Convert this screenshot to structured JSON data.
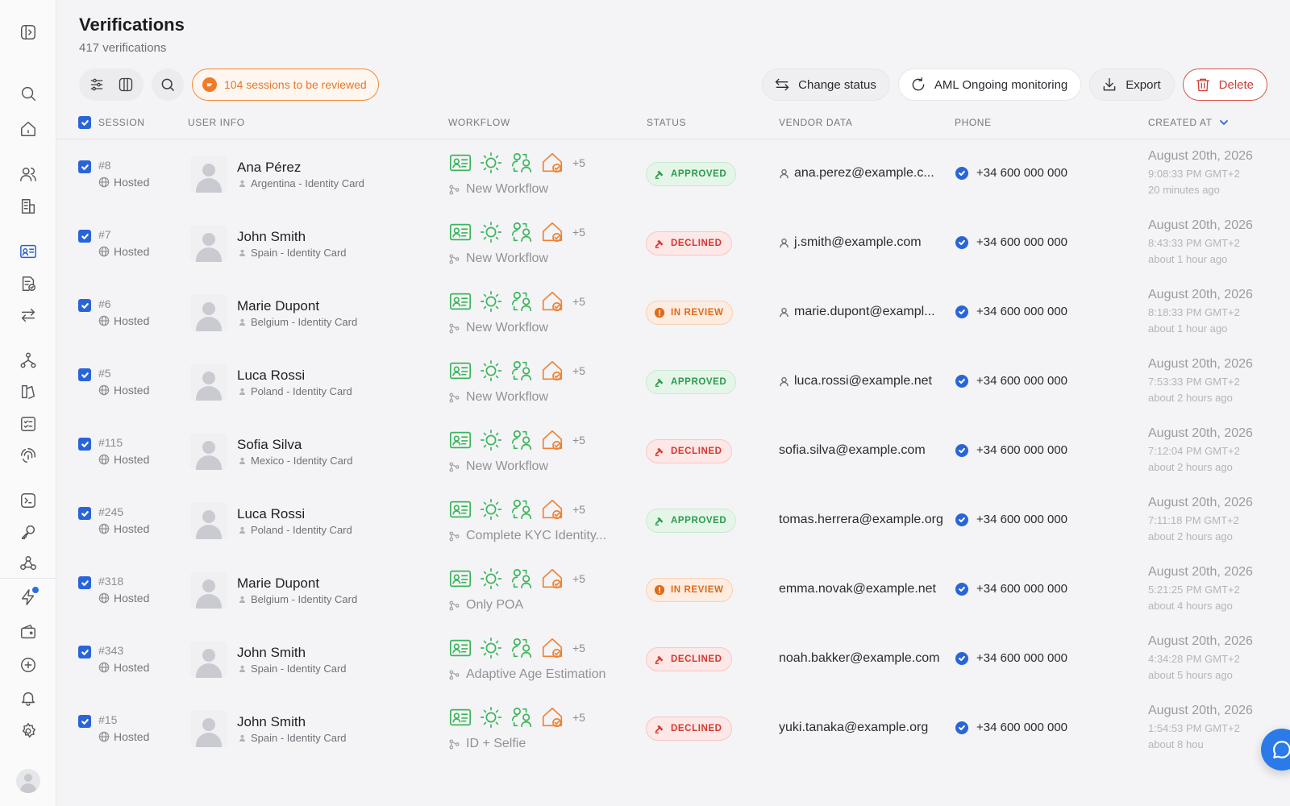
{
  "page": {
    "title": "Verifications",
    "subtitle": "417 verifications"
  },
  "toolbar": {
    "review_pill": "104 sessions to be reviewed",
    "change_status": "Change status",
    "aml": "AML Ongoing monitoring",
    "export": "Export",
    "delete": "Delete"
  },
  "columns": {
    "session": "SESSION",
    "user_info": "USER INFO",
    "workflow": "WORKFLOW",
    "status": "STATUS",
    "vendor_data": "VENDOR DATA",
    "phone": "PHONE",
    "created_at": "CREATED AT"
  },
  "status_labels": {
    "approved": "APPROVED",
    "declined": "DECLINED",
    "review": "IN REVIEW"
  },
  "colors": {
    "accent": "#2a65d8",
    "approved": "#2c9a4d",
    "declined": "#d5372e",
    "in_review": "#de6b1c",
    "workflow_green": "#3bb55b",
    "workflow_orange": "#ef8235"
  },
  "rows": [
    {
      "id": "#8",
      "type": "Hosted",
      "name": "Ana Pérez",
      "meta": "Argentina - Identity Card",
      "wf_more": "+5",
      "workflow": "New Workflow",
      "status": "APPROVED",
      "status_kind": "approved",
      "vendor": "ana.perez@example.c...",
      "vendor_icon": true,
      "phone": "+34 600 000 000",
      "date": "August 20th, 2026",
      "time": "9:08:33 PM GMT+2",
      "ago": "20 minutes ago"
    },
    {
      "id": "#7",
      "type": "Hosted",
      "name": "John Smith",
      "meta": "Spain - Identity Card",
      "wf_more": "+5",
      "workflow": "New Workflow",
      "status": "DECLINED",
      "status_kind": "declined",
      "vendor": "j.smith@example.com",
      "vendor_icon": true,
      "phone": "+34 600 000 000",
      "date": "August 20th, 2026",
      "time": "8:43:33 PM GMT+2",
      "ago": "about 1 hour ago"
    },
    {
      "id": "#6",
      "type": "Hosted",
      "name": "Marie Dupont",
      "meta": "Belgium - Identity Card",
      "wf_more": "+5",
      "workflow": "New Workflow",
      "status": "IN REVIEW",
      "status_kind": "review",
      "vendor": "marie.dupont@exampl...",
      "vendor_icon": true,
      "phone": "+34 600 000 000",
      "date": "August 20th, 2026",
      "time": "8:18:33 PM GMT+2",
      "ago": "about 1 hour ago"
    },
    {
      "id": "#5",
      "type": "Hosted",
      "name": "Luca Rossi",
      "meta": "Poland - Identity Card",
      "wf_more": "+5",
      "workflow": "New Workflow",
      "status": "APPROVED",
      "status_kind": "approved",
      "vendor": "luca.rossi@example.net",
      "vendor_icon": true,
      "phone": "+34 600 000 000",
      "date": "August 20th, 2026",
      "time": "7:53:33 PM GMT+2",
      "ago": "about 2 hours ago"
    },
    {
      "id": "#115",
      "type": "Hosted",
      "name": "Sofia Silva",
      "meta": "Mexico - Identity Card",
      "wf_more": "+5",
      "workflow": "New Workflow",
      "status": "DECLINED",
      "status_kind": "declined",
      "vendor": "sofia.silva@example.com",
      "vendor_icon": false,
      "phone": "+34 600 000 000",
      "date": "August 20th, 2026",
      "time": "7:12:04 PM GMT+2",
      "ago": "about 2 hours ago"
    },
    {
      "id": "#245",
      "type": "Hosted",
      "name": "Luca Rossi",
      "meta": "Poland - Identity Card",
      "wf_more": "+5",
      "workflow": "Complete KYC Identity...",
      "status": "APPROVED",
      "status_kind": "approved",
      "vendor": "tomas.herrera@example.org",
      "vendor_icon": false,
      "phone": "+34 600 000 000",
      "date": "August 20th, 2026",
      "time": "7:11:18 PM GMT+2",
      "ago": "about 2 hours ago"
    },
    {
      "id": "#318",
      "type": "Hosted",
      "name": "Marie Dupont",
      "meta": "Belgium - Identity Card",
      "wf_more": "+5",
      "workflow": "Only POA",
      "status": "IN REVIEW",
      "status_kind": "review",
      "vendor": "emma.novak@example.net",
      "vendor_icon": false,
      "phone": "+34 600 000 000",
      "date": "August 20th, 2026",
      "time": "5:21:25 PM GMT+2",
      "ago": "about 4 hours ago"
    },
    {
      "id": "#343",
      "type": "Hosted",
      "name": "John Smith",
      "meta": "Spain - Identity Card",
      "wf_more": "+5",
      "workflow": "Adaptive Age Estimation",
      "status": "DECLINED",
      "status_kind": "declined",
      "vendor": "noah.bakker@example.com",
      "vendor_icon": false,
      "phone": "+34 600 000 000",
      "date": "August 20th, 2026",
      "time": "4:34:28 PM GMT+2",
      "ago": "about 5 hours ago"
    },
    {
      "id": "#15",
      "type": "Hosted",
      "name": "John Smith",
      "meta": "Spain - Identity Card",
      "wf_more": "+5",
      "workflow": "ID + Selfie",
      "status": "DECLINED",
      "status_kind": "declined",
      "vendor": "yuki.tanaka@example.org",
      "vendor_icon": false,
      "phone": "+34 600 000 000",
      "date": "August 20th, 2026",
      "time": "1:54:53 PM GMT+2",
      "ago": "about 8 hou"
    }
  ]
}
